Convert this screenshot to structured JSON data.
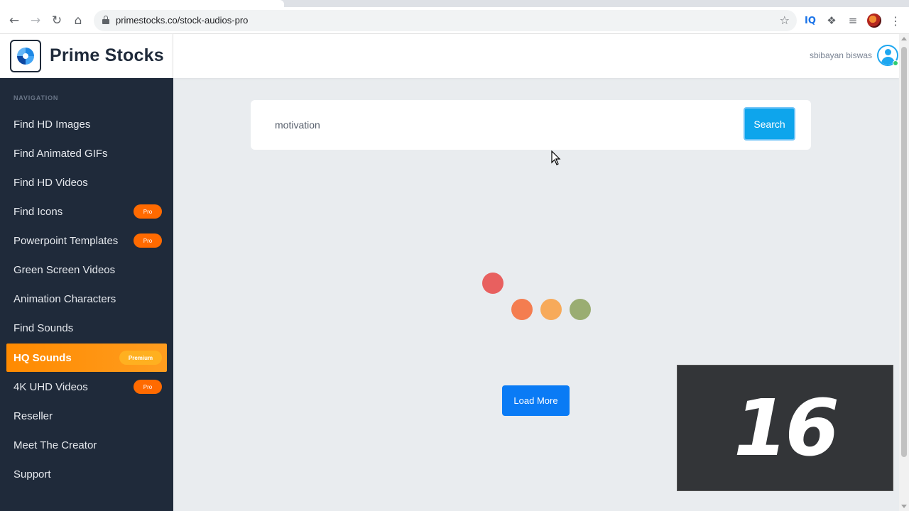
{
  "browser": {
    "url": "primestocks.co/stock-audios-pro",
    "icons": {
      "back": "arrow-back-icon",
      "forward": "arrow-forward-icon",
      "reload": "reload-icon",
      "home": "home-icon",
      "bookmark": "star-icon",
      "extension_iq": "IQ",
      "extensions": "puzzle-icon",
      "media": "media-control-icon",
      "menu": "kebab-menu-icon"
    }
  },
  "brand": {
    "name": "Prime Stocks"
  },
  "sidebar": {
    "heading": "NAVIGATION",
    "items": [
      {
        "label": "Find HD Images"
      },
      {
        "label": "Find Animated GIFs"
      },
      {
        "label": "Find HD Videos"
      },
      {
        "label": "Find Icons",
        "badge": "Pro"
      },
      {
        "label": "Powerpoint Templates",
        "badge": "Pro"
      },
      {
        "label": "Green Screen Videos"
      },
      {
        "label": "Animation Characters"
      },
      {
        "label": "Find Sounds"
      },
      {
        "label": "HQ Sounds",
        "badge": "Premium",
        "active": true
      },
      {
        "label": "4K UHD Videos",
        "badge": "Pro"
      },
      {
        "label": "Reseller"
      },
      {
        "label": "Meet The Creator"
      },
      {
        "label": "Support"
      }
    ]
  },
  "header": {
    "username": "sbibayan biswas"
  },
  "search": {
    "value": "motivation",
    "button_label": "Search"
  },
  "main": {
    "load_more_label": "Load More"
  },
  "overlay": {
    "counter": "16"
  },
  "colors": {
    "sidebar_bg": "#1f2a3a",
    "active_item": "#ff8a00",
    "badge_pro": "#ff6a00",
    "search_button": "#0ea5ec",
    "load_more": "#0a7bf5"
  }
}
